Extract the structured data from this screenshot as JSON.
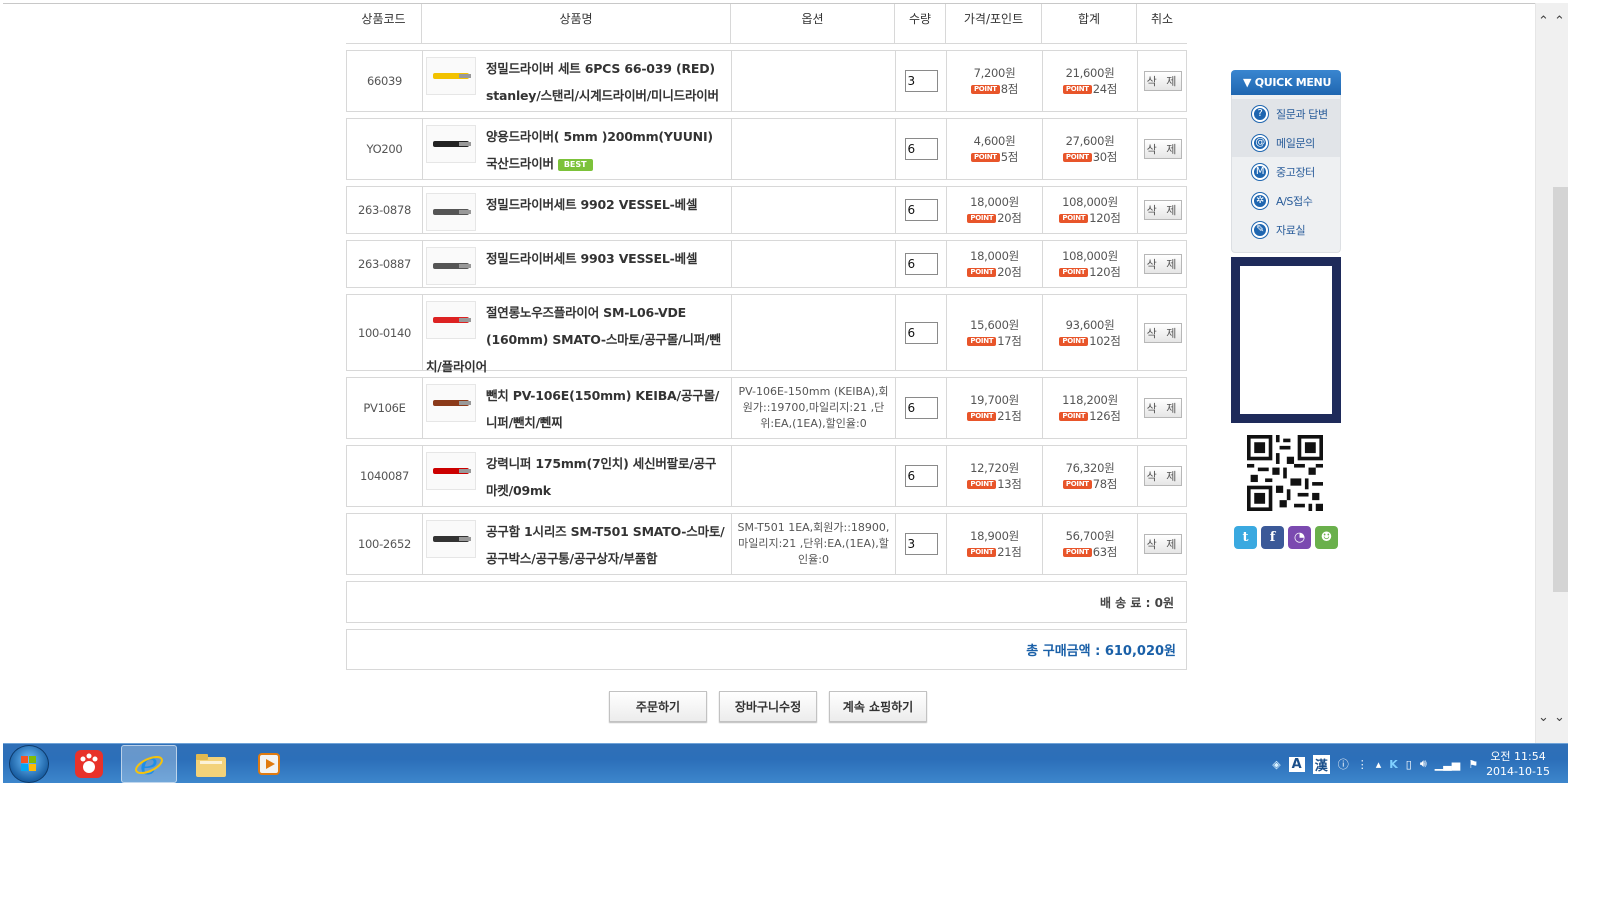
{
  "table": {
    "headers": [
      "상품코드",
      "상품명",
      "옵션",
      "수량",
      "가격/포인트",
      "합계",
      "취소"
    ],
    "point_badge": "POINT",
    "delete_label": "삭 제",
    "rows": [
      {
        "code": "66039",
        "name": "정밀드라이버 세트 6PCS 66-039 (RED) stanley/스탠리/시계드라이버/미니드라이버",
        "option": "",
        "qty": "3",
        "price": "7,200원",
        "price_point": "8점",
        "total": "21,600원",
        "total_point": "24점",
        "best": ""
      },
      {
        "code": "YO200",
        "name": "양용드라이버( 5mm )200mm(YUUNI) 국산드라이버",
        "option": "",
        "qty": "6",
        "price": "4,600원",
        "price_point": "5점",
        "total": "27,600원",
        "total_point": "30점",
        "best": "BEST"
      },
      {
        "code": "263-0878",
        "name": "정밀드라이버세트 9902 VESSEL-베셀",
        "option": "",
        "qty": "6",
        "price": "18,000원",
        "price_point": "20점",
        "total": "108,000원",
        "total_point": "120점",
        "best": ""
      },
      {
        "code": "263-0887",
        "name": "정밀드라이버세트 9903 VESSEL-베셀",
        "option": "",
        "qty": "6",
        "price": "18,000원",
        "price_point": "20점",
        "total": "108,000원",
        "total_point": "120점",
        "best": ""
      },
      {
        "code": "100-0140",
        "name": "절연롱노우즈플라이어 SM-L06-VDE (160mm) SMATO-스마토/공구몰/니퍼/뺀치/플라이어",
        "option": "",
        "qty": "6",
        "price": "15,600원",
        "price_point": "17점",
        "total": "93,600원",
        "total_point": "102점",
        "best": ""
      },
      {
        "code": "PV106E",
        "name": "뺀치 PV-106E(150mm) KEIBA/공구몰/니퍼/뺀치/뻰찌",
        "option": "PV-106E-150mm (KEIBA),회원가::19700,마일리지:21 ,단위:EA,(1EA),할인율:0",
        "qty": "6",
        "price": "19,700원",
        "price_point": "21점",
        "total": "118,200원",
        "total_point": "126점",
        "best": ""
      },
      {
        "code": "1040087",
        "name": "강력니퍼 175mm(7인치) 세신버팔로/공구마켓/09mk",
        "option": "",
        "qty": "6",
        "price": "12,720원",
        "price_point": "13점",
        "total": "76,320원",
        "total_point": "78점",
        "best": ""
      },
      {
        "code": "100-2652",
        "name": "공구함 1시리즈 SM-T501 SMATO-스마토/공구박스/공구통/공구상자/부품함",
        "option": "SM-T501 1EA,회원가::18900,마일리지:21 ,단위:EA,(1EA),할인율:0",
        "qty": "3",
        "price": "18,900원",
        "price_point": "21점",
        "total": "56,700원",
        "total_point": "63점",
        "best": ""
      }
    ],
    "shipping": "배 송 료 : 0원",
    "grand_total": "총 구매금액 : 610,020원"
  },
  "actions": {
    "order": "주문하기",
    "edit_cart": "장바구니수정",
    "continue": "계속 쇼핑하기"
  },
  "quick_menu": {
    "title": "▼ QUICK MENU",
    "items": [
      "질문과 답변",
      "메일문의",
      "중고장터",
      "A/S접수",
      "자료실"
    ]
  },
  "taskbar": {
    "ime_lang": "A",
    "ime_hanja": "漢",
    "time": "오전 11:54",
    "date": "2014-10-15"
  }
}
